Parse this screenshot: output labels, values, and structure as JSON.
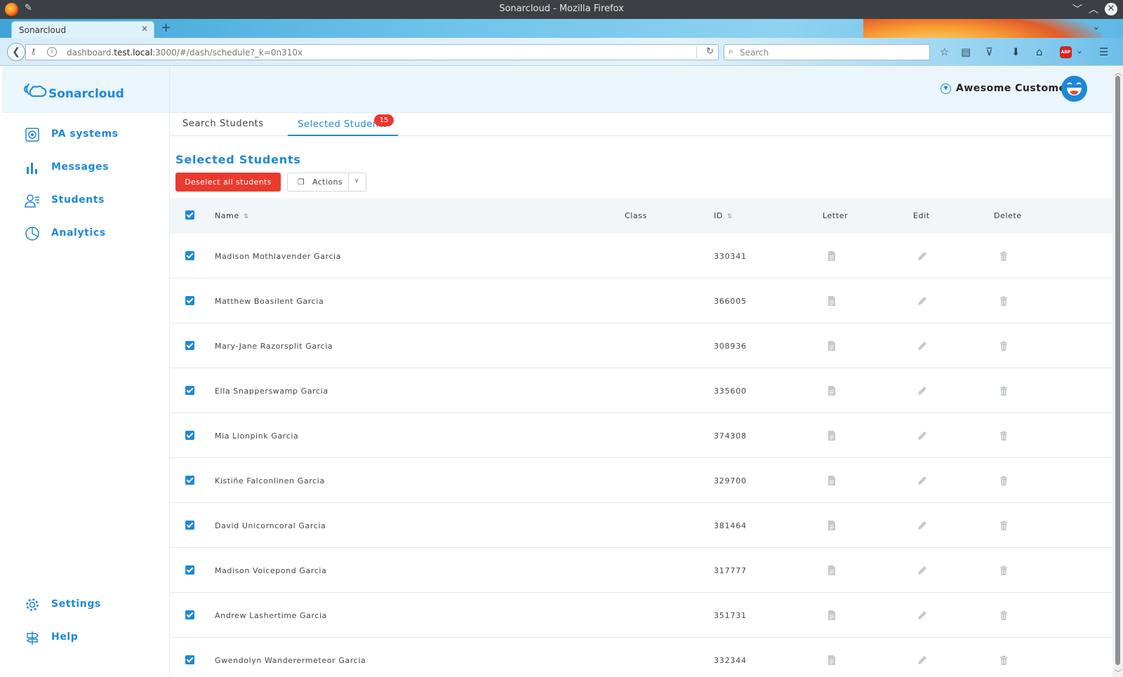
{
  "window": {
    "title": "Sonarcloud - Mozilla Firefox"
  },
  "browser": {
    "tab_label": "Sonarcloud",
    "url_prefix": "dashboard.",
    "url_host": "test.local",
    "url_rest": ":3000/#/dash/schedule?_k=0n310x",
    "search_placeholder": "Search"
  },
  "brand": {
    "name": "Sonarcloud",
    "accent_color": "#1e88d6"
  },
  "user": {
    "name": "Awesome Customer"
  },
  "sidebar": {
    "items": [
      {
        "label": "PA systems",
        "icon": "pa-system-icon"
      },
      {
        "label": "Messages",
        "icon": "bar-chart-icon"
      },
      {
        "label": "Students",
        "icon": "students-icon"
      },
      {
        "label": "Analytics",
        "icon": "pie-chart-icon"
      }
    ],
    "bottom_items": [
      {
        "label": "Settings",
        "icon": "gear-icon"
      },
      {
        "label": "Help",
        "icon": "signpost-icon"
      }
    ]
  },
  "tabs": {
    "search": "Search Students",
    "selected": "Selected Students",
    "selected_count": "15"
  },
  "main": {
    "title": "Selected Students",
    "deselect_label": "Deselect all students",
    "actions_label": "Actions"
  },
  "table": {
    "headers": {
      "name": "Name",
      "class": "Class",
      "id": "ID",
      "letter": "Letter",
      "edit": "Edit",
      "delete": "Delete"
    },
    "rows": [
      {
        "name": "Madison Mothlavender Garcia",
        "class": "",
        "id": "330341"
      },
      {
        "name": "Matthew Boasilent Garcia",
        "class": "",
        "id": "366005"
      },
      {
        "name": "Mary-Jane Razorsplit Garcia",
        "class": "",
        "id": "308936"
      },
      {
        "name": "Ella Snapperswamp Garcia",
        "class": "",
        "id": "335600"
      },
      {
        "name": "Mia Lionpink Garcia",
        "class": "",
        "id": "374308"
      },
      {
        "name": "Kistiñe Falconlinen Garcia",
        "class": "",
        "id": "329700"
      },
      {
        "name": "David Unicorncoral Garcia",
        "class": "",
        "id": "381464"
      },
      {
        "name": "Madison Voicepond Garcia",
        "class": "",
        "id": "317777"
      },
      {
        "name": "Andrew Lashertime Garcia",
        "class": "",
        "id": "351731"
      },
      {
        "name": "Gwendolyn Wanderermeteor Garcia",
        "class": "",
        "id": "332344"
      }
    ]
  }
}
